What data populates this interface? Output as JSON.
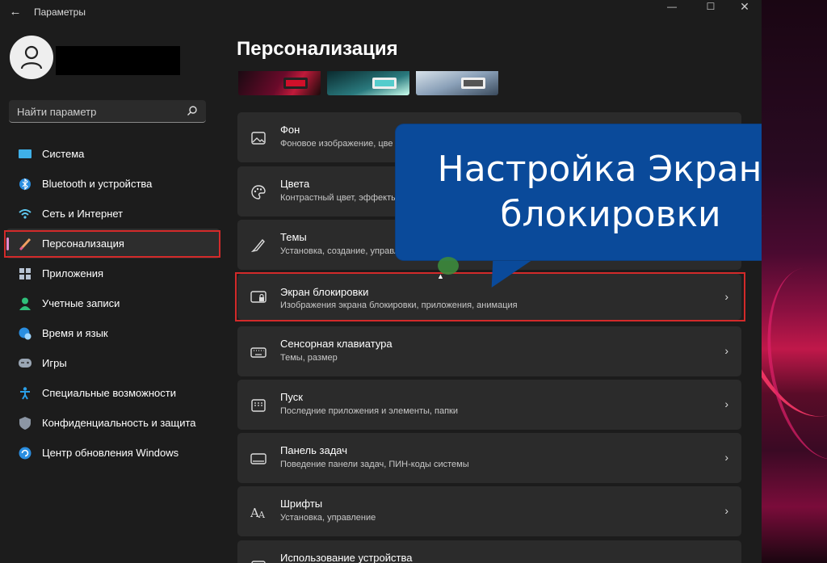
{
  "window": {
    "title": "Параметры"
  },
  "search": {
    "placeholder": "Найти параметр"
  },
  "nav": [
    {
      "label": "Система",
      "icon": "monitor-icon"
    },
    {
      "label": "Bluetooth и устройства",
      "icon": "bluetooth-icon"
    },
    {
      "label": "Сеть и Интернет",
      "icon": "wifi-icon"
    },
    {
      "label": "Персонализация",
      "icon": "brush-icon",
      "active": true
    },
    {
      "label": "Приложения",
      "icon": "apps-icon"
    },
    {
      "label": "Учетные записи",
      "icon": "person-icon"
    },
    {
      "label": "Время и язык",
      "icon": "globe-clock-icon"
    },
    {
      "label": "Игры",
      "icon": "gamepad-icon"
    },
    {
      "label": "Специальные возможности",
      "icon": "accessibility-icon"
    },
    {
      "label": "Конфиденциальность и защита",
      "icon": "shield-icon"
    },
    {
      "label": "Центр обновления Windows",
      "icon": "update-icon"
    }
  ],
  "page": {
    "title": "Персонализация"
  },
  "cards": [
    {
      "title": "Фон",
      "subtitle": "Фоновое изображение, цве",
      "icon": "image-icon"
    },
    {
      "title": "Цвета",
      "subtitle": "Контрастный цвет, эффекты",
      "icon": "palette-icon"
    },
    {
      "title": "Темы",
      "subtitle": "Установка, создание, управле",
      "icon": "brush-icon"
    },
    {
      "title": "Экран блокировки",
      "subtitle": "Изображения экрана блокировки, приложения, анимация",
      "icon": "lock-screen-icon"
    },
    {
      "title": "Сенсорная клавиатура",
      "subtitle": "Темы, размер",
      "icon": "keyboard-icon"
    },
    {
      "title": "Пуск",
      "subtitle": "Последние приложения и элементы, папки",
      "icon": "start-icon"
    },
    {
      "title": "Панель задач",
      "subtitle": "Поведение панели задач, ПИН-коды системы",
      "icon": "taskbar-icon"
    },
    {
      "title": "Шрифты",
      "subtitle": "Установка, управление",
      "icon": "fonts-icon"
    },
    {
      "title": "Использование устройства",
      "subtitle": "",
      "icon": "device-usage-icon"
    }
  ],
  "callout": {
    "line1": "Настройка Экрана",
    "line2": "блокировки"
  },
  "colors": {
    "accent": "#e48bd0",
    "highlight": "#d32a2a",
    "callout": "#0a4a9a"
  }
}
